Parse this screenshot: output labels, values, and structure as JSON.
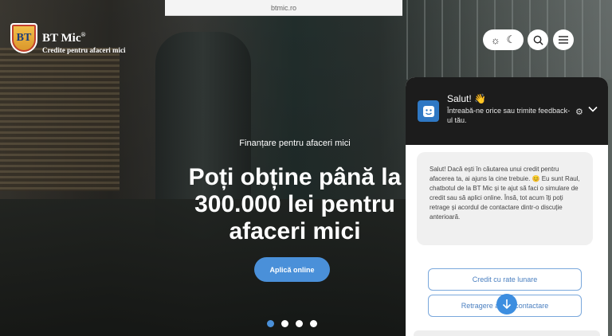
{
  "browser": {
    "url": "btmic.ro"
  },
  "brand": {
    "logo_letters": "BT",
    "title": "BT Mic",
    "registered": "®",
    "subtitle": "Credite pentru afaceri mici"
  },
  "header": {
    "theme_light_icon": "sun-icon",
    "theme_dark_icon": "moon-icon",
    "search_icon": "search-icon",
    "menu_icon": "menu-icon"
  },
  "hero": {
    "eyebrow": "Finanțare pentru afaceri mici",
    "headline": "Poți obține până la 300.000 lei pentru afaceri mici",
    "cta_label": "Aplică online",
    "slides_total": 4,
    "active_slide": 1
  },
  "chat": {
    "title": "Salut! 👋",
    "subtitle": "Întreabă-ne orice sau trimite feedback-ul tău.",
    "message": "Salut! Dacă ești în căutarea unui credit pentru afacerea ta, ai ajuns la cine trebuie. 😊 Eu sunt Raul, chatbotul de la BT Mic și te ajut să faci o simulare de credit sau să aplici online. Însă, tot acum îți poți retrage și acordul de contactare dintr-o discuție anterioară.",
    "quick_replies": [
      "Credit cu rate lunare",
      "Retragere acord contactare"
    ],
    "accent": "#3d8ee0"
  },
  "colors": {
    "primary": "#4a90d9",
    "header_dark": "#1c1c1c"
  }
}
